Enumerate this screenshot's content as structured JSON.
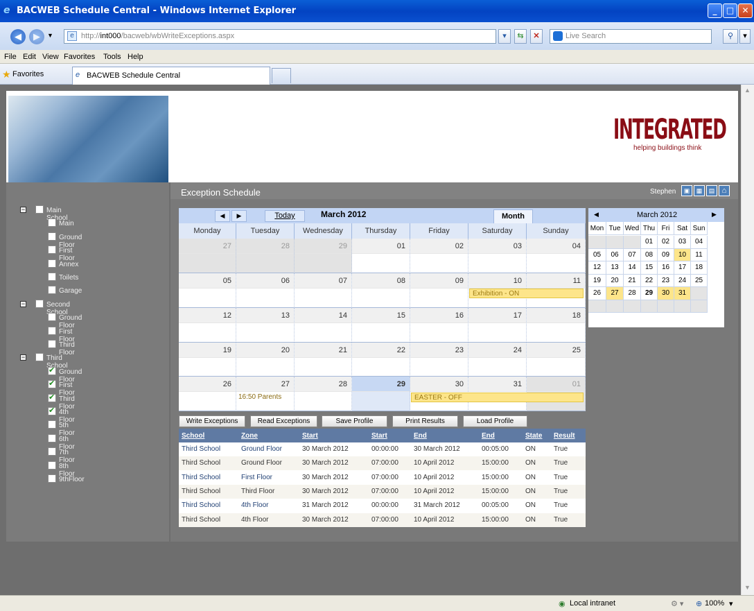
{
  "window": {
    "title": "BACWEB Schedule Central - Windows Internet Explorer"
  },
  "address": {
    "url_prefix": "http://",
    "url_host": "int000",
    "url_path": "/bacweb/wbWriteExceptions.aspx",
    "search_placeholder": "Live Search"
  },
  "menu": [
    "File",
    "Edit",
    "View",
    "Favorites",
    "Tools",
    "Help"
  ],
  "favorites": {
    "label": "Favorites",
    "tab": "BACWEB Schedule Central"
  },
  "banner": {
    "logo": "INTEGRATED",
    "tagline": "helping buildings think"
  },
  "header": {
    "title": "Exception Schedule",
    "user": "Stephen"
  },
  "tree": [
    {
      "label": "Main School",
      "level": 0,
      "checked": false
    },
    {
      "label": "Main",
      "level": 1,
      "checked": false
    },
    {
      "label": "Ground Floor",
      "level": 1,
      "checked": false
    },
    {
      "label": "First Floor",
      "level": 1,
      "checked": false
    },
    {
      "label": "Annex",
      "level": 1,
      "checked": false
    },
    {
      "label": "Toilets",
      "level": 1,
      "checked": false
    },
    {
      "label": "Garage",
      "level": 1,
      "checked": false
    },
    {
      "label": "Second School",
      "level": 0,
      "checked": false
    },
    {
      "label": "Ground Floor",
      "level": 1,
      "checked": false
    },
    {
      "label": "First Floor",
      "level": 1,
      "checked": false
    },
    {
      "label": "Third Floor",
      "level": 1,
      "checked": false
    },
    {
      "label": "Third School",
      "level": 0,
      "checked": false
    },
    {
      "label": "Ground Floor",
      "level": 1,
      "checked": true
    },
    {
      "label": "First Floor",
      "level": 1,
      "checked": true
    },
    {
      "label": "Third Floor",
      "level": 1,
      "checked": true
    },
    {
      "label": "4th Floor",
      "level": 1,
      "checked": true
    },
    {
      "label": "5th Floor",
      "level": 1,
      "checked": false
    },
    {
      "label": "6th Floor",
      "level": 1,
      "checked": false
    },
    {
      "label": "7th Floor",
      "level": 1,
      "checked": false
    },
    {
      "label": "8th Floor",
      "level": 1,
      "checked": false
    },
    {
      "label": "9thFloor",
      "level": 1,
      "checked": false
    }
  ],
  "calendar": {
    "today_label": "Today",
    "month_title": "March 2012",
    "view_tab": "Month",
    "day_names": [
      "Monday",
      "Tuesday",
      "Wednesday",
      "Thursday",
      "Friday",
      "Saturday",
      "Sunday"
    ],
    "weeks": [
      [
        "27",
        "28",
        "29",
        "01",
        "02",
        "03",
        "04"
      ],
      [
        "05",
        "06",
        "07",
        "08",
        "09",
        "10",
        "11"
      ],
      [
        "12",
        "13",
        "14",
        "15",
        "16",
        "17",
        "18"
      ],
      [
        "19",
        "20",
        "21",
        "22",
        "23",
        "24",
        "25"
      ],
      [
        "26",
        "27",
        "28",
        "29",
        "30",
        "31",
        "01"
      ]
    ],
    "events": {
      "exhibition": "Exhibition - ON",
      "parents": "16:50 Parents",
      "easter": "EASTER - OFF"
    }
  },
  "minical": {
    "title": "March 2012",
    "day_names": [
      "Mon",
      "Tue",
      "Wed",
      "Thu",
      "Fri",
      "Sat",
      "Sun"
    ],
    "weeks": [
      [
        "",
        "",
        "",
        "01",
        "02",
        "03",
        "04"
      ],
      [
        "05",
        "06",
        "07",
        "08",
        "09",
        "10",
        "11"
      ],
      [
        "12",
        "13",
        "14",
        "15",
        "16",
        "17",
        "18"
      ],
      [
        "19",
        "20",
        "21",
        "22",
        "23",
        "24",
        "25"
      ],
      [
        "26",
        "27",
        "28",
        "29",
        "30",
        "31",
        ""
      ],
      [
        "",
        "",
        "",
        "",
        "",
        "",
        ""
      ]
    ]
  },
  "actions": [
    "Write Exceptions",
    "Read Exceptions",
    "Save Profile",
    "Print Results",
    "Load Profile"
  ],
  "table": {
    "headers": [
      "School",
      "Zone",
      "Start",
      "Start",
      "End",
      "End",
      "State",
      "Result"
    ],
    "rows": [
      [
        "Third School",
        "Ground Floor",
        "30 March 2012",
        "00:00:00",
        "30 March 2012",
        "00:05:00",
        "ON",
        "True"
      ],
      [
        "Third School",
        "Ground Floor",
        "30 March 2012",
        "07:00:00",
        "10 April 2012",
        "15:00:00",
        "ON",
        "True"
      ],
      [
        "Third School",
        "First Floor",
        "30 March 2012",
        "07:00:00",
        "10 April 2012",
        "15:00:00",
        "ON",
        "True"
      ],
      [
        "Third School",
        "Third Floor",
        "30 March 2012",
        "07:00:00",
        "10 April 2012",
        "15:00:00",
        "ON",
        "True"
      ],
      [
        "Third School",
        "4th Floor",
        "31 March 2012",
        "00:00:00",
        "31 March 2012",
        "00:05:00",
        "ON",
        "True"
      ],
      [
        "Third School",
        "4th Floor",
        "30 March 2012",
        "07:00:00",
        "10 April 2012",
        "15:00:00",
        "ON",
        "True"
      ]
    ]
  },
  "status": {
    "zone": "Local intranet",
    "zoom": "100%"
  }
}
